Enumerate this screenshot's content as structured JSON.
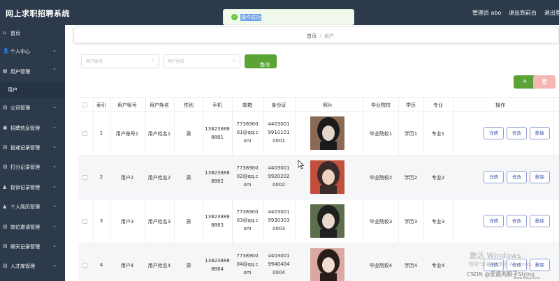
{
  "app": {
    "title": "网上求职招聘系统"
  },
  "header": {
    "admin_label": "管理员 abo",
    "front_label": "退出到前台",
    "logout_label": "退出登录"
  },
  "toast": {
    "message": "操作成功"
  },
  "sidebar": {
    "items": [
      {
        "label": "首页",
        "icon": "home-icon",
        "glyph": "⌂",
        "chevron": false
      },
      {
        "label": "个人中心",
        "icon": "user-icon",
        "glyph": "👤",
        "chevron": true
      },
      {
        "label": "用户管理",
        "icon": "grid-icon",
        "glyph": "▦",
        "chevron": true,
        "expanded": true
      },
      {
        "label": "公司管理",
        "icon": "building-icon",
        "glyph": "▤",
        "chevron": true
      },
      {
        "label": "招聘信息管理",
        "icon": "briefcase-icon",
        "glyph": "▣",
        "chevron": true
      },
      {
        "label": "投递记录管理",
        "icon": "send-icon",
        "glyph": "▤",
        "chevron": true
      },
      {
        "label": "打分记录管理",
        "icon": "star-icon",
        "glyph": "▤",
        "chevron": true
      },
      {
        "label": "投诉记录管理",
        "icon": "alert-icon",
        "glyph": "▲",
        "chevron": true
      },
      {
        "label": "个人简历管理",
        "icon": "resume-icon",
        "glyph": "▲",
        "chevron": true
      },
      {
        "label": "岗位邀请管理",
        "icon": "invite-icon",
        "glyph": "▤",
        "chevron": true
      },
      {
        "label": "聊天记录管理",
        "icon": "chat-icon",
        "glyph": "▤",
        "chevron": true
      },
      {
        "label": "人才库管理",
        "icon": "talent-icon",
        "glyph": "▤",
        "chevron": true
      }
    ],
    "sub_item": "用户"
  },
  "breadcrumb": {
    "home": "首页",
    "sep": "/",
    "current": "用户"
  },
  "search": {
    "account_placeholder": "用户账号",
    "name_placeholder": "用户姓名",
    "button_label": "查询"
  },
  "actions": {
    "add_label": "+",
    "delete_label": "🗑"
  },
  "table": {
    "headers": [
      "索引",
      "用户账号",
      "用户姓名",
      "性别",
      "手机",
      "邮箱",
      "身份证",
      "照片",
      "毕业院校",
      "学历",
      "专业",
      "操作"
    ],
    "rows": [
      {
        "index": "1",
        "account": "用户账号1",
        "name": "用户姓名1",
        "gender": "男",
        "phone": [
          "13823888",
          "8881"
        ],
        "email": [
          "7738900",
          "01@qq.c",
          "om"
        ],
        "id_card": [
          "4403001",
          "9910101",
          "0001"
        ],
        "school": "毕业院校1",
        "education": "学历1",
        "major": "专业1",
        "photo_palette": [
          "#1b1b1b",
          "#e4d6c8",
          "#8a6a55"
        ]
      },
      {
        "index": "2",
        "account": "用户2",
        "name": "用户姓名2",
        "gender": "男",
        "phone": [
          "13823888",
          "8882"
        ],
        "email": [
          "7738900",
          "02@qq.c",
          "om"
        ],
        "id_card": [
          "4403001",
          "9920202",
          "0002"
        ],
        "school": "毕业院校2",
        "education": "学历2",
        "major": "专业2",
        "photo_palette": [
          "#3b2a2a",
          "#f0d2c0",
          "#c04f3c"
        ]
      },
      {
        "index": "3",
        "account": "用户3",
        "name": "用户姓名3",
        "gender": "男",
        "phone": [
          "13823888",
          "8883"
        ],
        "email": [
          "7738900",
          "03@qq.c",
          "om"
        ],
        "id_card": [
          "4403001",
          "9930303",
          "0003"
        ],
        "school": "毕业院校3",
        "education": "学历3",
        "major": "专业3",
        "photo_palette": [
          "#202020",
          "#e8d9cc",
          "#5d6e4c"
        ]
      },
      {
        "index": "4",
        "account": "用户4",
        "name": "用户姓名4",
        "gender": "男",
        "phone": [
          "13823888",
          "8884"
        ],
        "email": [
          "7738900",
          "04@qq.c",
          "om"
        ],
        "id_card": [
          "4403001",
          "9940404",
          "0004"
        ],
        "school": "毕业院校4",
        "education": "学历4",
        "major": "专业4",
        "photo_palette": [
          "#2a1d18",
          "#f2ddd0",
          "#d9a8a0"
        ]
      }
    ],
    "row_buttons": [
      "详情",
      "修改",
      "删除"
    ]
  },
  "overlay": {
    "activate_title": "激活 Windows",
    "activate_hint": "转到\"设置\"以激活 Windows。",
    "csdn": "CSDN @爱晨两颗子String",
    "site": "www.9itpy.com"
  }
}
